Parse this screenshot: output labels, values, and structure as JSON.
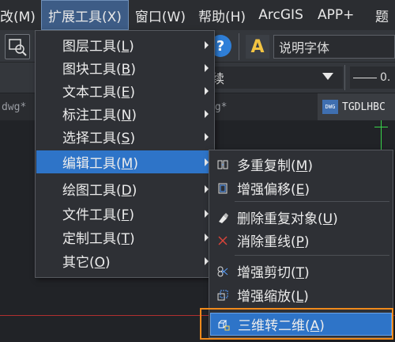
{
  "menubar": {
    "items": [
      "改(M)",
      "扩展工具(X)",
      "窗口(W)",
      "帮助(H)",
      "ArcGIS",
      "APP+",
      "题"
    ]
  },
  "toolbar": {
    "help_icon_text": "?",
    "text_style_icon": "A",
    "text_font_value": "说明字体",
    "layer_value": "续",
    "lineweight_value": "0."
  },
  "tabs": {
    "left": "dwg*",
    "middle": "wg*",
    "right": "TGDLHBC",
    "dwg_badge": "DWG"
  },
  "main_menu": {
    "items": [
      {
        "text": "图层工具",
        "key": "L"
      },
      {
        "text": "图块工具",
        "key": "B"
      },
      {
        "text": "文本工具",
        "key": "E"
      },
      {
        "text": "标注工具",
        "key": "N"
      },
      {
        "text": "选择工具",
        "key": "S"
      },
      {
        "text": "编辑工具",
        "key": "M"
      },
      {
        "text": "绘图工具",
        "key": "D"
      },
      {
        "text": "文件工具",
        "key": "F"
      },
      {
        "text": "定制工具",
        "key": "T"
      },
      {
        "text": "其它",
        "key": "O"
      }
    ]
  },
  "sub_menu": {
    "items": [
      {
        "text": "多重复制",
        "key": "M",
        "icon": "multi-copy-icon"
      },
      {
        "text": "增强偏移",
        "key": "E",
        "icon": "offset-icon"
      },
      {
        "text": "删除重复对象",
        "key": "U",
        "icon": "delete-duplicates-icon"
      },
      {
        "text": "消除重线",
        "key": "P",
        "icon": "remove-overlap-icon"
      },
      {
        "text": "增强剪切",
        "key": "T",
        "icon": "trim-icon"
      },
      {
        "text": "增强缩放",
        "key": "L",
        "icon": "scale-icon"
      },
      {
        "text": "三维转二维",
        "key": "A",
        "icon": "3d-to-2d-icon"
      }
    ]
  },
  "colors": {
    "highlight": "#2e74c8",
    "callout": "#f08a1b"
  }
}
